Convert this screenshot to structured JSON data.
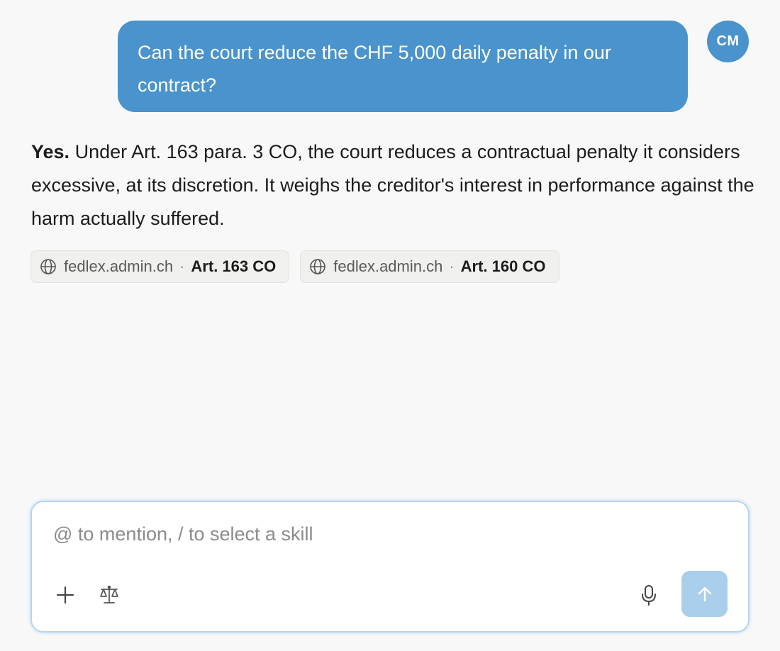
{
  "conversation": {
    "user": {
      "avatar_initials": "CM",
      "message": "Can the court reduce the CHF 5,000 daily penalty in our contract?"
    },
    "assistant": {
      "lead": "Yes.",
      "body": " Under Art. 163 para. 3 CO, the court reduces a contractual penalty it considers excessive, at its discretion. It weighs the creditor's interest in performance against the harm actually suffered.",
      "sources": [
        {
          "domain": "fedlex.admin.ch",
          "separator": "·",
          "reference": "Art. 163 CO",
          "icon": "globe-icon"
        },
        {
          "domain": "fedlex.admin.ch",
          "separator": "·",
          "reference": "Art. 160 CO",
          "icon": "globe-icon"
        }
      ]
    }
  },
  "composer": {
    "placeholder": "@ to mention, / to select a skill",
    "value": "",
    "tools": {
      "attach_icon": "plus-icon",
      "skill_icon": "scales-icon",
      "voice_icon": "microphone-icon",
      "send_icon": "arrow-up-icon"
    }
  },
  "colors": {
    "accent": "#4a93cc",
    "send_button": "#a9cfec",
    "background": "#f8f8f8"
  }
}
